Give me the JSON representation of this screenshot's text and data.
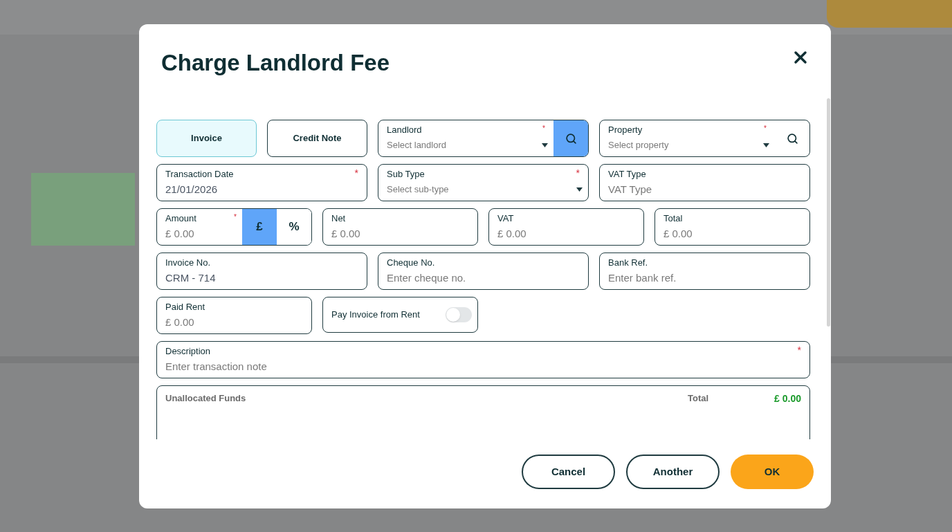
{
  "dialog": {
    "title": "Charge Landlord Fee"
  },
  "type_buttons": [
    {
      "label": "Invoice",
      "selected": true
    },
    {
      "label": "Credit Note",
      "selected": false
    }
  ],
  "row_1": [
    {
      "kind": "select",
      "label": "Landlord",
      "placeholder": "Select landlord",
      "required_mark": "*",
      "search_button": true,
      "search_filled": true
    },
    {
      "kind": "select",
      "label": "Property",
      "placeholder": "Select property",
      "required_mark": "*",
      "search_button": true,
      "search_filled": false
    }
  ],
  "row_2": [
    {
      "kind": "text",
      "label": "Transaction Date",
      "value": "21/01/2026",
      "required_mark": "*"
    },
    {
      "kind": "select",
      "label": "Sub Type",
      "placeholder": "Select sub-type",
      "required_mark": "*",
      "search_button": false
    },
    {
      "kind": "text",
      "label": "VAT Type",
      "placeholder": "VAT Type"
    }
  ],
  "amount": {
    "label": "Amount",
    "placeholder": "£ 0.00",
    "required_mark": "*",
    "units": [
      {
        "label": "£",
        "selected": true
      },
      {
        "label": "%",
        "selected": false
      }
    ]
  },
  "row_3": [
    {
      "label": "Net",
      "placeholder": "£ 0.00"
    },
    {
      "label": "VAT",
      "placeholder": "£ 0.00"
    },
    {
      "label": "Total",
      "placeholder": "£ 0.00"
    }
  ],
  "row_4": [
    {
      "label": "Invoice No.",
      "value": "CRM - 714"
    },
    {
      "label": "Cheque No.",
      "placeholder": "Enter cheque no."
    },
    {
      "label": "Bank Ref.",
      "placeholder": "Enter bank ref."
    }
  ],
  "paid_rent": {
    "label": "Paid Rent",
    "placeholder": "£ 0.00"
  },
  "pay_from_rent": {
    "label": "Pay Invoice from Rent",
    "on": false
  },
  "description": {
    "label": "Description",
    "placeholder": "Enter transaction note",
    "required_mark": "*"
  },
  "unallocated": {
    "label": "Unallocated Funds",
    "total_label": "Total",
    "total": "£ 0.00"
  },
  "buttons": [
    {
      "label": "Cancel",
      "kind": "secondary"
    },
    {
      "label": "Another",
      "kind": "secondary"
    },
    {
      "label": "OK",
      "kind": "primary"
    }
  ]
}
